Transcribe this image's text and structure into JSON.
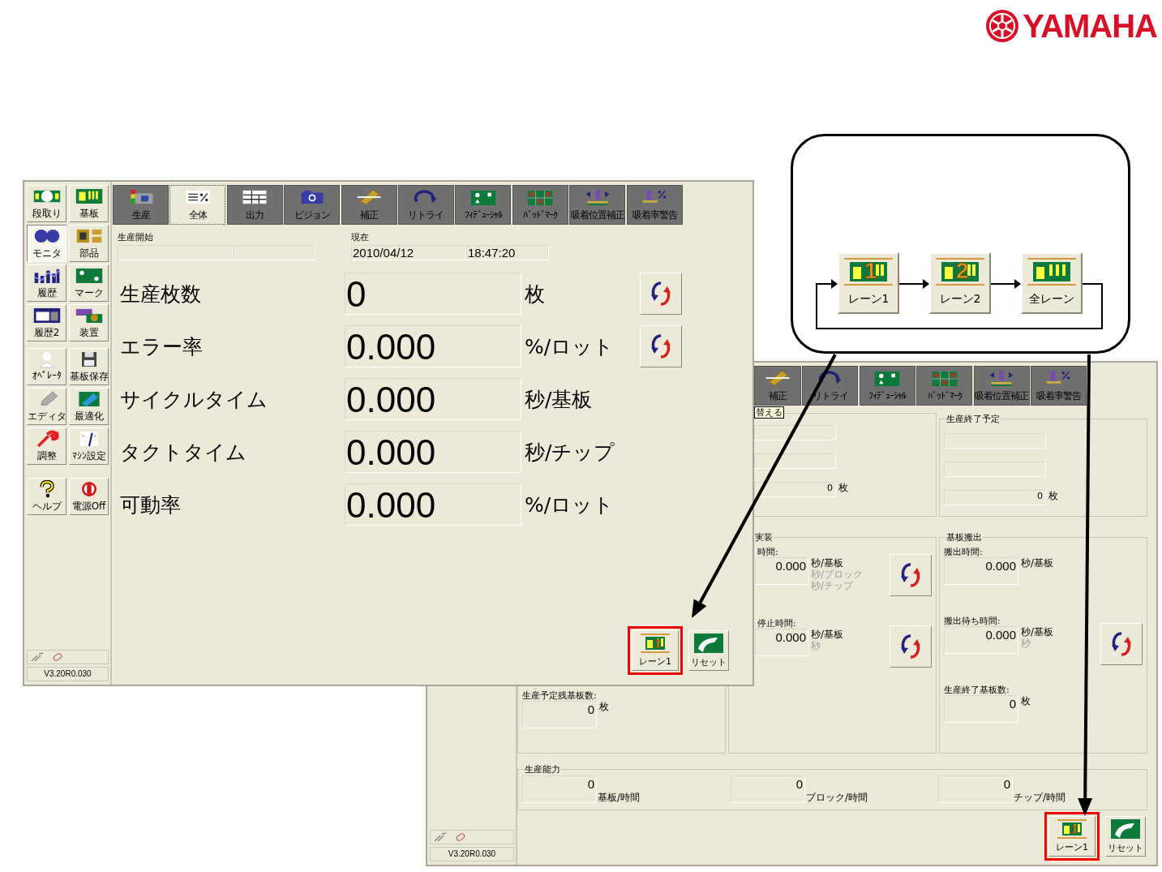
{
  "logo": {
    "text": "YAMAHA"
  },
  "back_window": {
    "tabs": [
      {
        "label": "補正",
        "selected": false
      },
      {
        "label": "リトライ",
        "selected": false
      },
      {
        "label": "ﾌｨﾃﾞｭｰｼｬﾙ",
        "selected": false
      },
      {
        "label": "ﾊﾞｯﾄﾞﾏｰｸ",
        "selected": false
      },
      {
        "label": "吸着位置補正",
        "selected": false
      },
      {
        "label": "吸着率警告",
        "selected": false
      }
    ],
    "tooltip": "替える",
    "top_panels": [
      {
        "fields": [
          {
            "kind": "blank"
          },
          {
            "kind": "blank"
          },
          {
            "kind": "count",
            "value": "0",
            "unit": "枚"
          }
        ]
      },
      {
        "title": "生産終了予定",
        "fields": [
          {
            "kind": "blank"
          },
          {
            "kind": "blank"
          },
          {
            "kind": "count",
            "value": "0",
            "unit": "枚"
          }
        ]
      }
    ],
    "mid_panels": [
      {
        "items": [
          {
            "label": "生産予定残基板数:",
            "value": "0",
            "units": [
              {
                "text": "枚",
                "disabled": false
              }
            ],
            "refresh": false
          }
        ]
      },
      {
        "title": "実装",
        "items": [
          {
            "label": "時間:",
            "value": "0.000",
            "units": [
              {
                "text": "秒/基板",
                "disabled": false
              },
              {
                "text": "秒/ブロック",
                "disabled": true
              },
              {
                "text": "秒/チップ",
                "disabled": true
              }
            ],
            "refresh": true
          },
          {
            "label": "停止時間:",
            "value": "0.000",
            "units": [
              {
                "text": "秒/基板",
                "disabled": false
              },
              {
                "text": "秒",
                "disabled": true
              }
            ],
            "refresh": true
          }
        ]
      },
      {
        "title": "基板搬出",
        "items": [
          {
            "label": "搬出時間:",
            "value": "0.000",
            "units": [
              {
                "text": "秒/基板",
                "disabled": false
              }
            ],
            "refresh": false
          },
          {
            "label": "搬出待ち時間:",
            "value": "0.000",
            "units": [
              {
                "text": "秒/基板",
                "disabled": false
              },
              {
                "text": "秒",
                "disabled": true
              }
            ],
            "refresh": true
          },
          {
            "label": "生産終了基板数:",
            "value": "0",
            "units": [
              {
                "text": "枚",
                "disabled": false
              }
            ],
            "refresh": false
          }
        ]
      }
    ],
    "capability": {
      "title": "生産能力",
      "items": [
        {
          "value": "0",
          "unit": "基板/時間"
        },
        {
          "value": "0",
          "unit": "ブロック/時間"
        },
        {
          "value": "0",
          "unit": "チップ/時間"
        }
      ]
    },
    "buttons": [
      {
        "kind": "lane",
        "label": "レーン1",
        "icon_digit": "1",
        "highlighted": true
      },
      {
        "kind": "reset",
        "label": "リセット",
        "highlighted": false
      }
    ],
    "version": "V3.20R0.030"
  },
  "front_window": {
    "sidebar": {
      "groups": [
        {
          "items": [
            {
              "label": "段取り",
              "selected": false
            },
            {
              "label": "基板",
              "selected": false
            },
            {
              "label": "モニタ",
              "selected": true
            },
            {
              "label": "部品",
              "selected": false
            },
            {
              "label": "履歴",
              "selected": false
            },
            {
              "label": "マーク",
              "selected": false
            },
            {
              "label": "履歴2",
              "selected": false
            },
            {
              "label": "装置",
              "selected": false
            }
          ]
        },
        {
          "items": [
            {
              "label": "ｵﾍﾟﾚｰﾀ",
              "selected": false
            },
            {
              "label": "基板保存",
              "selected": false
            },
            {
              "label": "エディタ",
              "selected": false
            },
            {
              "label": "最適化",
              "selected": false
            },
            {
              "label": "調整",
              "selected": false
            },
            {
              "label": "ﾏｼﾝ設定",
              "selected": false
            }
          ]
        },
        {
          "items": [
            {
              "label": "ヘルプ",
              "selected": false
            },
            {
              "label": "電源Off",
              "selected": false
            }
          ]
        }
      ],
      "version": "V3.20R0.030"
    },
    "tabs": [
      {
        "label": "生産",
        "selected": false
      },
      {
        "label": "全体",
        "selected": true
      },
      {
        "label": "出力",
        "selected": false
      },
      {
        "label": "ビジョン",
        "selected": false
      },
      {
        "label": "補正",
        "selected": false
      },
      {
        "label": "リトライ",
        "selected": false
      },
      {
        "label": "ﾌｨﾃﾞｭｰｼｬﾙ",
        "selected": false
      },
      {
        "label": "ﾊﾞｯﾄﾞﾏｰｸ",
        "selected": false
      },
      {
        "label": "吸着位置補正",
        "selected": false
      },
      {
        "label": "吸着率警告",
        "selected": false
      }
    ],
    "start": {
      "label": "生産開始"
    },
    "now": {
      "label": "現在",
      "date": "2010/04/12",
      "time": "18:47:20"
    },
    "metrics": [
      {
        "label": "生産枚数",
        "value": "0",
        "unit": "枚",
        "refresh": true
      },
      {
        "label": "エラー率",
        "value": "0.000",
        "unit": "%/ロット",
        "refresh": true
      },
      {
        "label": "サイクルタイム",
        "value": "0.000",
        "unit": "秒/基板",
        "refresh": false
      },
      {
        "label": "タクトタイム",
        "value": "0.000",
        "unit": "秒/チップ",
        "refresh": false
      },
      {
        "label": "可動率",
        "value": "0.000",
        "unit": "%/ロット",
        "refresh": false
      }
    ],
    "buttons": [
      {
        "kind": "lane",
        "label": "レーン1",
        "icon_digit": "1",
        "highlighted": true
      },
      {
        "kind": "reset",
        "label": "リセット",
        "highlighted": false
      }
    ]
  },
  "callout": {
    "lanes": [
      {
        "label": "レーン1",
        "icon_digit": "1"
      },
      {
        "label": "レーン2",
        "icon_digit": "2"
      },
      {
        "label": "全レーン"
      }
    ]
  }
}
